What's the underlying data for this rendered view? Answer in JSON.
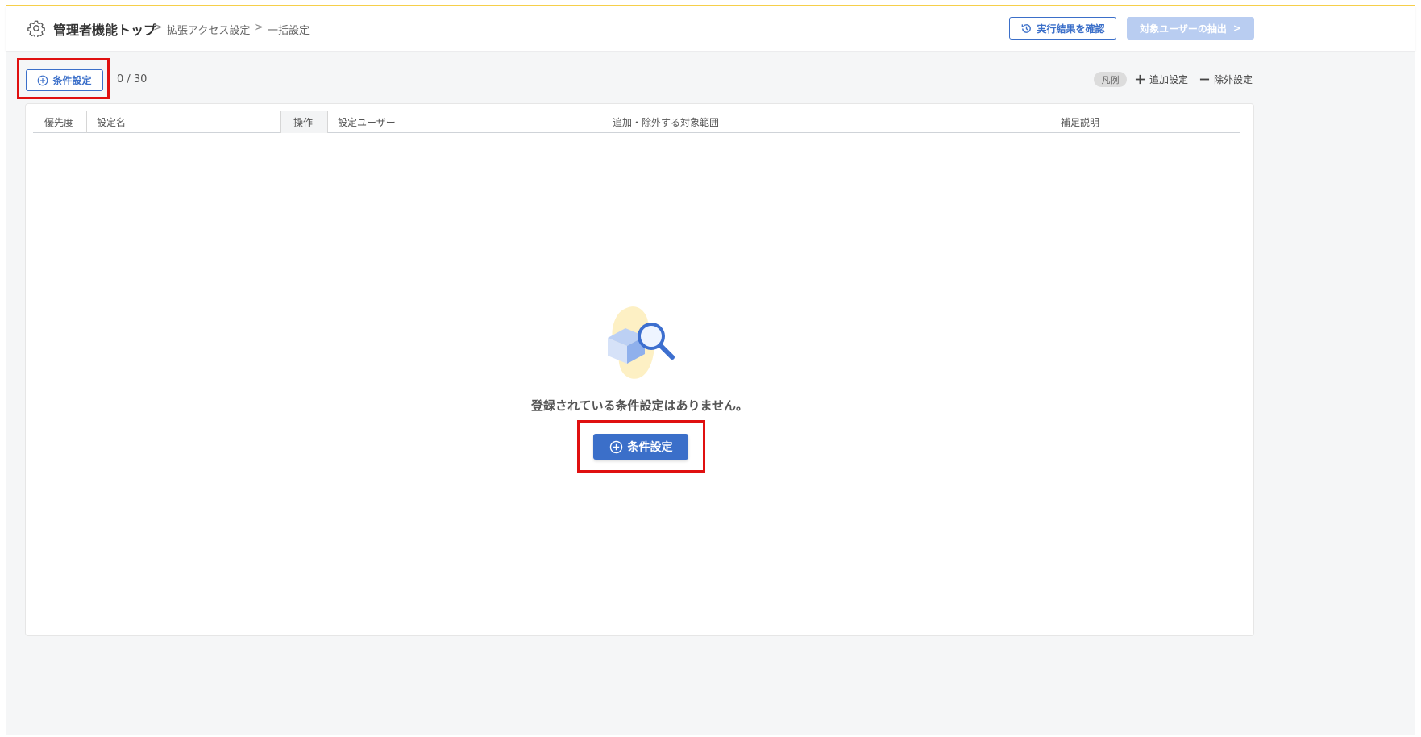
{
  "header": {
    "breadcrumb": {
      "title": "管理者機能トップ",
      "items": [
        "拡張アクセス設定",
        "一括設定"
      ],
      "separator": ">"
    },
    "check_results_label": "実行結果を確認",
    "extract_users_label": "対象ユーザーの抽出",
    "extract_chevron": ">"
  },
  "toolbar": {
    "add_condition_label": "条件設定",
    "count": "0 / 30",
    "legend": {
      "badge": "凡例",
      "add_label": "追加設定",
      "exclude_label": "除外設定"
    }
  },
  "table": {
    "columns": [
      "優先度",
      "設定名",
      "操作",
      "設定ユーザー",
      "追加・除外する対象範囲",
      "補足説明"
    ]
  },
  "empty_state": {
    "message": "登録されている条件設定はありません。",
    "button_label": "条件設定"
  },
  "colors": {
    "accent": "#3b6fc9",
    "accent_disabled": "#b9cdf1",
    "top_border": "#f6cf4a",
    "highlight": "#e01010"
  }
}
